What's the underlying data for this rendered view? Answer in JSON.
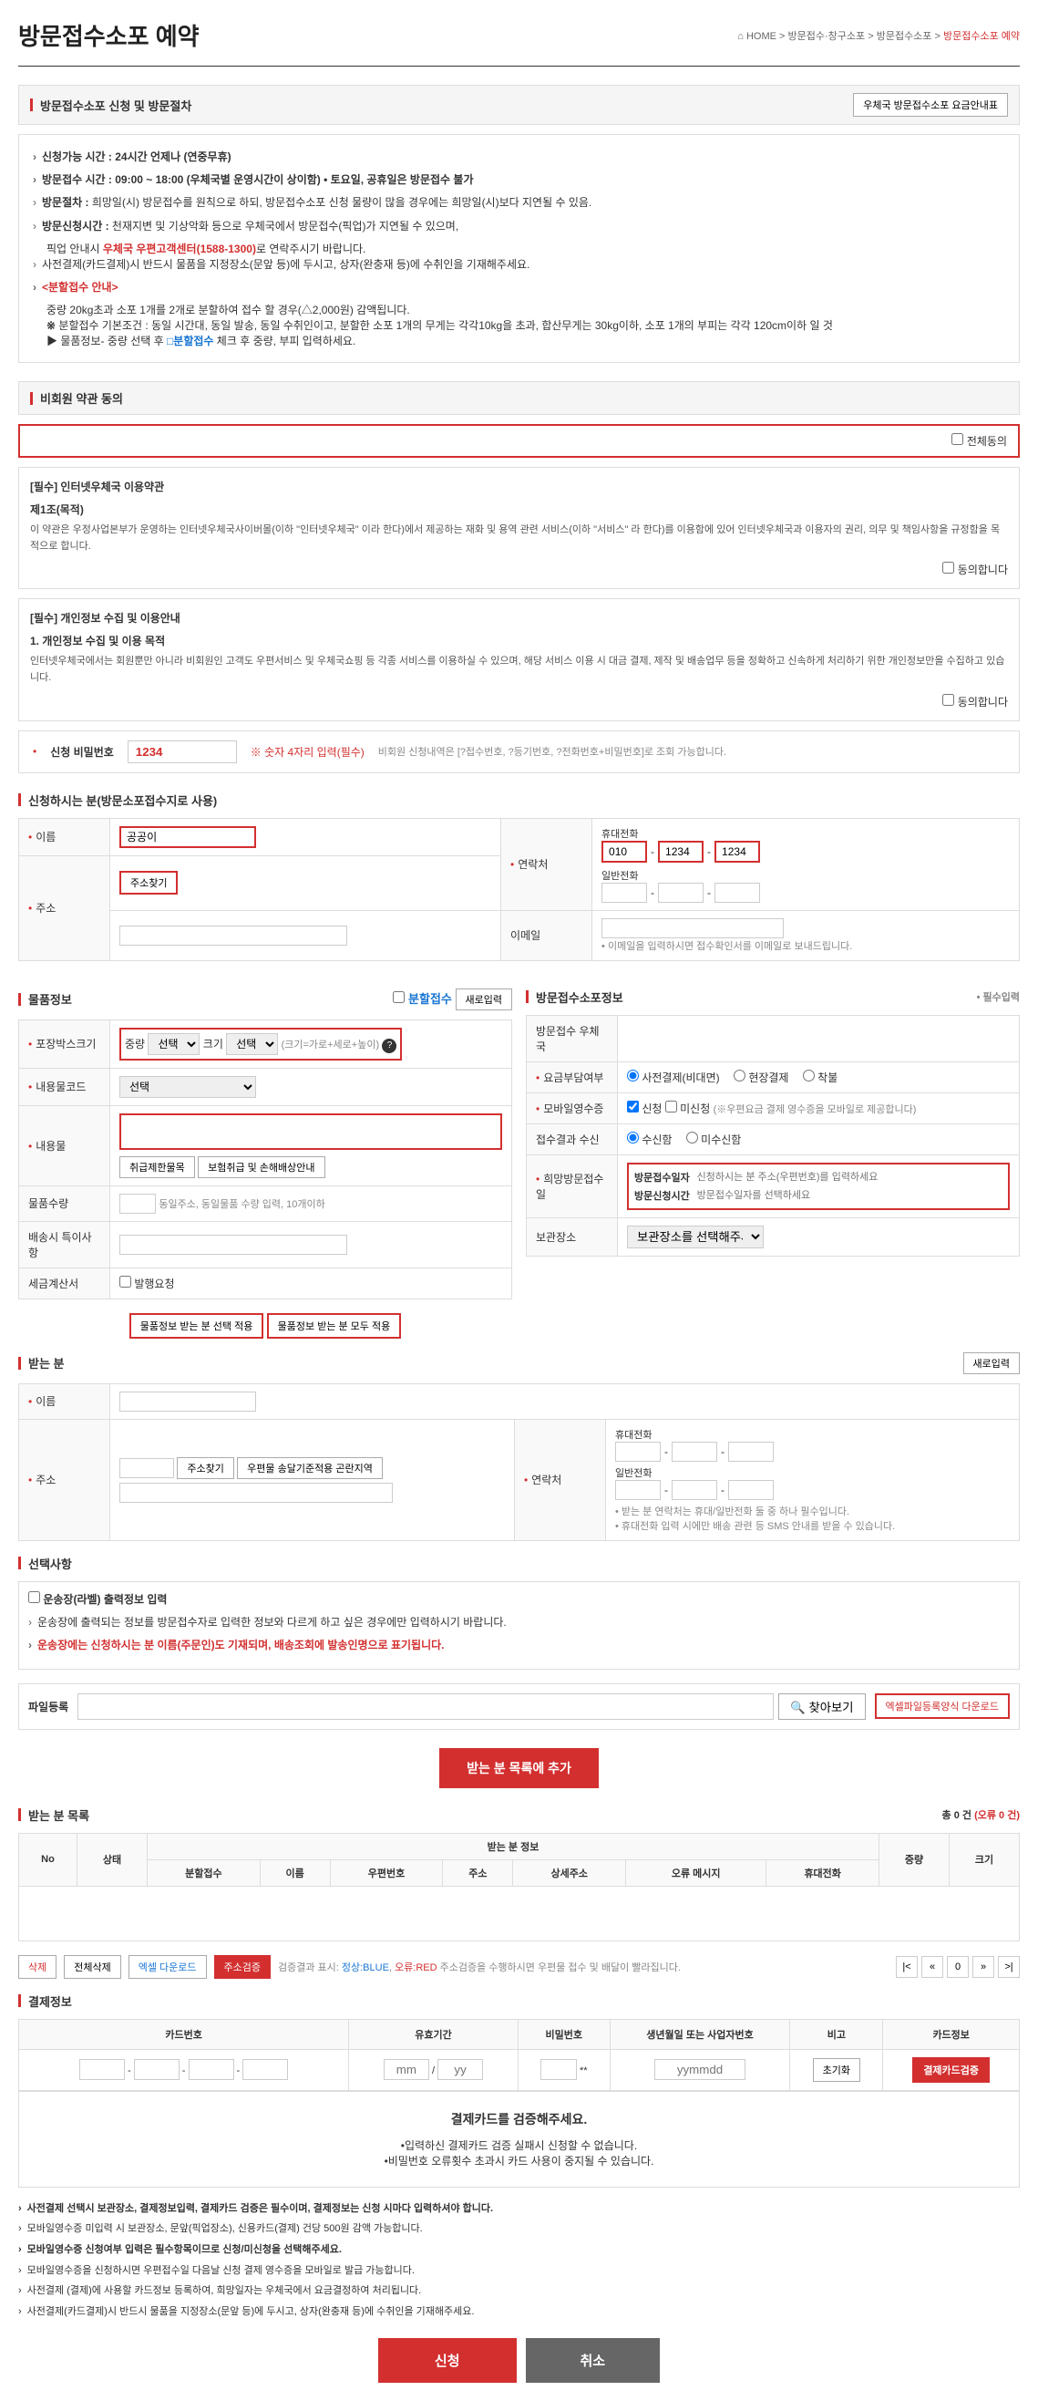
{
  "page": {
    "title": "방문접수소포 예약",
    "breadcrumb": {
      "home": "HOME",
      "l1": "방문접수·창구소포",
      "l2": "방문접수소포",
      "l3": "방문접수소포 예약"
    }
  },
  "guide_header": "방문접수소포 신청 및 방문절차",
  "fee_btn": "우체국 방문접수소포 요금안내표",
  "guide": {
    "g1": "신청가능 시간 : 24시간 언제나 (연중무휴)",
    "g2": "방문접수 시간 : 09:00 ~ 18:00 (우체국별 운영시간이 상이함) • 토요일, 공휴일은 방문접수 불가",
    "g3_label": "방문절차 : ",
    "g3": "희망일(시) 방문접수를 원칙으로 하되, 방문접수소포 신청 물량이 많을 경우에는 희망일(시)보다 지연될 수 있음.",
    "g4_label": "방문신청시간 : ",
    "g4": "천재지변 및 기상악화 등으로 우체국에서 방문접수(픽업)가 지연될 수 있으며,",
    "g4_sub": "픽업 안내시 ",
    "g4_sub_red": "우체국 우편고객센터(1588-1300)",
    "g4_sub2": "로 연락주시기 바랍니다.",
    "g5": "사전결제(카드결제)시 반드시 물품을 지정장소(문앞 등)에 두시고, 상자(완충재 등)에 수취인을 기재해주세요.",
    "g6_label": "<분할접수 안내>",
    "g6": "중량 20kg초과 소포 1개를 2개로 분할하여 접수 할 경우(△2,000원) 감액됩니다.",
    "g6_sub": "분할접수 기본조건 : 동일 시간대, 동일 발송, 동일 수취인이고, 분할한 소포 1개의 무게는 각각10kg을 초과, 합산무게는 30kg이하, 소포 1개의 부피는 각각 120cm이하 일 것",
    "g6_arrow": "▶ 물품정보- 중량 선택 후 ",
    "g6_split": "□분할접수",
    "g6_after": " 체크 후 중량, 부피 입력하세요."
  },
  "nonmember_header": "비회원 약관 동의",
  "agree_all": "전체동의",
  "terms1": {
    "title": "[필수] 인터넷우체국 이용약관",
    "article": "제1조(목적)",
    "content": "이 약관은 우정사업본부가 운영하는 인터넷우체국사이버몰(이하 \"인터넷우체국\" 이라 한다)에서 제공하는 재화 및 용역 관련 서비스(이하 \"서비스\" 라 한다)를 이용함에 있어 인터넷우체국과 이용자의 권리, 의무 및 책임사항을 규정함을 목적으로 합니다.",
    "agree": "동의합니다"
  },
  "terms2": {
    "title": "[필수] 개인정보 수집 및 이용안내",
    "article": "1. 개인정보 수집 및 이용 목적",
    "content": "인터넷우체국에서는 회원뿐만 아니라 비회원인 고객도 우편서비스 및 우체국쇼핑 등 각종 서비스를 이용하실 수 있으며, 해당 서비스 이용 시 대금 결제, 제작 및 배송업무 등을 정확하고 신속하게 처리하기 위한 개인정보만을 수집하고 있습니다.",
    "agree": "동의합니다"
  },
  "password": {
    "label": "신청 비밀번호",
    "value": "1234",
    "note": "※ 숫자 4자리 입력(필수)",
    "desc": "비회원 신청내역은 [?접수번호, ?등기번호, ?전화번호+비밀번호]로 조회 가능합니다."
  },
  "sender_header": "신청하시는 분(방문소포접수지로 사용)",
  "sender": {
    "name_label": "이름",
    "name": "공공이",
    "addr_label": "주소",
    "addr_btn": "주소찾기",
    "contact_label": "연락처",
    "mobile_label": "휴대전화",
    "landline_label": "일반전화",
    "phone1": "010",
    "phone2": "1234",
    "phone3": "1234",
    "email_label": "이메일",
    "email_note": "이메일을 입력하시면 접수확인서를 이메일로 보내드립니다."
  },
  "item_header": "물품정보",
  "split_label": "분할접수",
  "new_input": "새로입력",
  "item": {
    "box_label": "포장박스크기",
    "weight_label": "중량",
    "weight_sel": "선택",
    "size_label": "크기",
    "size_sel": "선택",
    "size_note": "(크기=가로+세로+높이)",
    "code_label": "내용물코드",
    "code_sel": "선택",
    "content_label": "내용물",
    "btn1": "취급제한물목",
    "btn2": "보험취급 및 손해배상안내",
    "qty_label": "물품수량",
    "qty_note": "동일주소, 동일물품 수량 입력, 10개이하",
    "special_label": "배송시 특이사항",
    "tax_label": "세금계산서",
    "tax_check": "발행요청"
  },
  "item_btns": {
    "b1": "물품정보 받는 분 선택 적용",
    "b2": "물품정보 받는 분 모두 적용"
  },
  "visit_header": "방문접수소포정보",
  "required_note": "필수입력",
  "visit": {
    "post_label": "방문접수 우체국",
    "fee_label": "요금부담여부",
    "fee_r1": "사전결제(비대면)",
    "fee_r2": "현장결제",
    "fee_r3": "착불",
    "mobile_label": "모바일영수증",
    "mobile_r1": "신청",
    "mobile_r2": "미신청",
    "mobile_note": "(※우편요금 결제 영수증을 모바일로 제공합니다)",
    "result_label": "접수결과 수신",
    "result_r1": "수신함",
    "result_r2": "미수신함",
    "hope_label": "희망방문접수일",
    "hope_date_label": "방문접수일자",
    "hope_date_ph": "신청하시는 분 주소(우편번호)를 입력하세요",
    "hope_time_label": "방문신청시간",
    "hope_time_ph": "방문접수일자를 선택하세요",
    "storage_label": "보관장소",
    "storage_sel": "보관장소를 선택해주세요"
  },
  "receiver_header": "받는 분",
  "receiver": {
    "name_label": "이름",
    "addr_label": "주소",
    "addr_btn": "주소찾기",
    "addr_btn2": "우편물 송달기준적용 곤란지역",
    "contact_label": "연락처",
    "mobile_label": "휴대전화",
    "landline_label": "일반전화",
    "note1": "받는 분 연락처는 휴대/일반전화 둘 중 하나 필수입니다.",
    "note2": "휴대전화 입력 시에만 배송 관련 등 SMS 안내를 받을 수 있습니다."
  },
  "option_header": "선택사항",
  "option": {
    "label": "운송장(라벨) 출력정보 입력",
    "desc": "운송장에 출력되는 정보를 방문접수자로 입력한 정보와 다르게 하고 싶은 경우에만 입력하시기 바랍니다.",
    "warn": "운송장에는 신청하시는 분 이름(주문인)도 기재되며, 배송조회에 발송인명으로 표기됩니다."
  },
  "file": {
    "label": "파일등록",
    "search": "찾아보기",
    "download": "엑셀파일등록양식 다운로드"
  },
  "add_btn": "받는 분 목록에 추가",
  "list_header": "받는 분 목록",
  "list": {
    "total": "총 0 건",
    "error": "(오류 0 건)",
    "cols": {
      "no": "No",
      "status": "상태",
      "receiver_info": "받는 분 정보",
      "weight": "중량",
      "size": "크기",
      "split": "분할접수",
      "name": "이름",
      "postal": "우편번호",
      "addr": "주소",
      "detail": "상세주소",
      "err": "오류 메시지",
      "mobile": "휴대전화",
      "landline": "일반전화"
    }
  },
  "actions": {
    "delete": "삭제",
    "delete_all": "전체삭제",
    "excel": "엑셀 다운로드",
    "verify": "주소검증",
    "verify_desc": "검증결과 표시: ",
    "normal": "정상:BLUE",
    "comma": ", ",
    "error": "오류:RED",
    "verify_note": "  주소검증을 수행하시면 우편물 접수 및 배달이 빨라집니다."
  },
  "page_num": "0",
  "payment_header": "결제정보",
  "payment": {
    "cols": {
      "card": "카드번호",
      "expire": "유효기간",
      "pw": "비밀번호",
      "birth": "생년월일 또는 사업자번호",
      "note": "비고",
      "info": "카드정보"
    },
    "exp_ph1": "mm",
    "exp_ph2": "yy",
    "exp_sep": "/",
    "pw_suffix": "**",
    "birth_ph": "yymmdd",
    "note_btn": "초기화",
    "verify_btn": "결제카드검증"
  },
  "payment_notice": {
    "title": "결제카드를 검증해주세요.",
    "l1": "•입력하신 결제카드 검증 실패시 신청할 수 없습니다.",
    "l2": "•비밀번호 오류횟수 초과시 카드 사용이 중지될 수 있습니다."
  },
  "final": {
    "f1": "사전결제 선택시 보관장소, 결제정보입력, 결제카드 검증은 필수이며, 결제정보는 신청 시마다 입력하셔야 합니다.",
    "f2": "모바일영수증 미입력 시 보관장소, 문앞(픽업장소), 신용카드(결제) 건당 500원 감액 가능합니다.",
    "f3": "모바일영수증 신청여부 입력은 필수항목이므로 신청/미신청을 선택해주세요.",
    "f4": "모바일영수증을 신청하시면 우편접수일 다음날 신청 결제 영수증을 모바일로 발급 가능합니다.",
    "f5": "사전결제 (결제)에 사용할 카드정보 등록하여, 희망일자는 우체국에서 요금결정하여 처리됩니다.",
    "f6": "사전결제(카드결제)시 반드시 물품을 지정장소(문앞 등)에 두시고, 상자(완충재 등)에 수취인을 기재해주세요."
  },
  "submit_btn": "신청",
  "cancel_btn": "취소"
}
